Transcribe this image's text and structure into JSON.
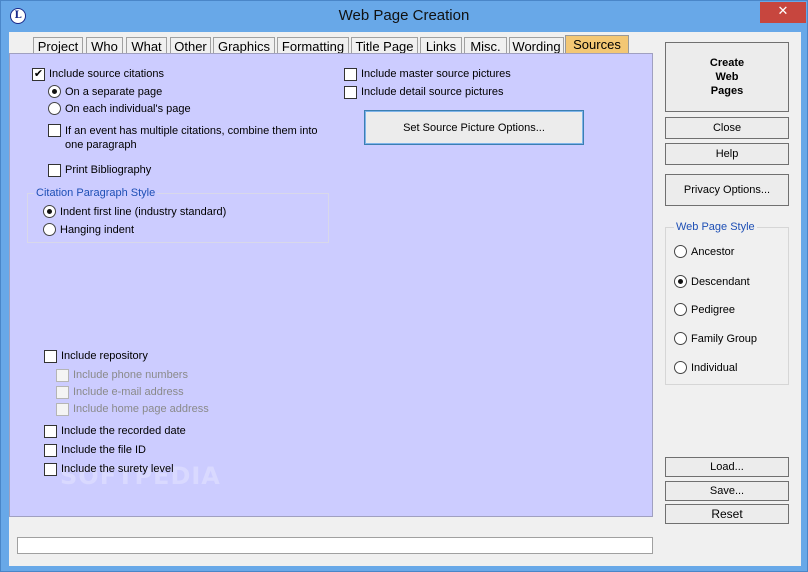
{
  "window": {
    "title": "Web Page Creation",
    "app_icon_glyph": "L",
    "close_glyph": "✕"
  },
  "tabs": [
    {
      "label": "Project"
    },
    {
      "label": "Who"
    },
    {
      "label": "What"
    },
    {
      "label": "Other"
    },
    {
      "label": "Graphics"
    },
    {
      "label": "Formatting"
    },
    {
      "label": "Title Page"
    },
    {
      "label": "Links"
    },
    {
      "label": "Misc."
    },
    {
      "label": "Wording"
    },
    {
      "label": "Sources",
      "active": true
    }
  ],
  "sources": {
    "include_source_citations": {
      "label": "Include source citations",
      "checked": true
    },
    "separate_page": {
      "label": "On a separate page",
      "selected": true
    },
    "each_page": {
      "label": "On each individual's page",
      "selected": false
    },
    "combine_citations": {
      "label": "If an event has multiple citations, combine them into one paragraph",
      "checked": false
    },
    "print_bibliography": {
      "label": "Print Bibliography",
      "checked": false
    },
    "citation_style": {
      "legend": "Citation Paragraph Style",
      "indent_first": {
        "label": "Indent first line (industry standard)",
        "selected": true
      },
      "hanging": {
        "label": "Hanging indent",
        "selected": false
      }
    },
    "include_master_pictures": {
      "label": "Include master source pictures",
      "checked": false
    },
    "include_detail_pictures": {
      "label": "Include detail source pictures",
      "checked": false
    },
    "set_picture_options_button": "Set Source Picture Options...",
    "include_repository": {
      "label": "Include repository",
      "checked": false
    },
    "include_phone": {
      "label": "Include phone numbers"
    },
    "include_email": {
      "label": "Include e-mail address"
    },
    "include_homepage": {
      "label": "Include home page address"
    },
    "include_recorded_date": {
      "label": "Include the recorded date",
      "checked": false
    },
    "include_file_id": {
      "label": "Include the file ID",
      "checked": false
    },
    "include_surety": {
      "label": "Include the surety level",
      "checked": false
    }
  },
  "watermark": "SOFTPEDIA",
  "side": {
    "create_button": "Create Web Pages",
    "close_button": "Close",
    "help_button": "Help",
    "privacy_button": "Privacy Options...",
    "style_group": {
      "legend": "Web Page Style",
      "options": [
        {
          "label": "Ancestor",
          "selected": false
        },
        {
          "label": "Descendant",
          "selected": true
        },
        {
          "label": "Pedigree",
          "selected": false
        },
        {
          "label": "Family Group",
          "selected": false
        },
        {
          "label": "Individual",
          "selected": false
        }
      ]
    },
    "load_button": "Load...",
    "save_button": "Save...",
    "reset_button": "Reset"
  },
  "statusbar": {
    "text": ""
  }
}
